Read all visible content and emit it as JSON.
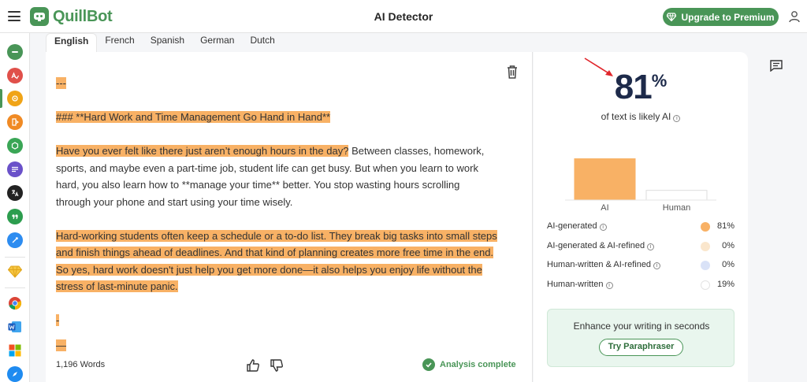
{
  "header": {
    "menu_icon": "hamburger-icon",
    "brand": "QuillBot",
    "title": "AI Detector",
    "premium_label": "Upgrade to Premium",
    "premium_icon": "diamond-icon",
    "account_icon": "user-icon"
  },
  "sidebar": {
    "items": [
      {
        "icon": "paraphraser-icon",
        "color": "#499557"
      },
      {
        "icon": "grammar-checker-icon",
        "color": "#e0504a"
      },
      {
        "icon": "ai-detector-icon",
        "color": "#f0a417",
        "active": true
      },
      {
        "icon": "plagiarism-checker-icon",
        "color": "#f08a24"
      },
      {
        "icon": "ai-humanizer-icon",
        "color": "#3aa656"
      },
      {
        "icon": "summarizer-icon",
        "color": "#6a51c9"
      },
      {
        "icon": "translator-icon",
        "color": "#222222"
      },
      {
        "icon": "citation-generator-icon",
        "color": "#2c9d4e"
      },
      {
        "icon": "quillbot-flow-icon",
        "color": "#2d8cf0"
      },
      {
        "icon": "premium-diamond-icon",
        "color": "#f0b323"
      },
      {
        "icon": "chrome-extension-icon",
        "color": "#4285f4"
      },
      {
        "icon": "word-addin-icon",
        "color": "#2b579a"
      },
      {
        "icon": "windows-app-icon",
        "color": "#f25022"
      },
      {
        "icon": "mac-app-icon",
        "color": "#1f8bf0"
      }
    ]
  },
  "tabs": [
    {
      "label": "English",
      "active": true
    },
    {
      "label": "French"
    },
    {
      "label": "Spanish"
    },
    {
      "label": "German"
    },
    {
      "label": "Dutch"
    }
  ],
  "editor": {
    "line1": "---",
    "heading": "### **Hard Work and Time Management Go Hand in Hand**",
    "p1_highlighted": "Have you ever felt like there just aren’t enough hours in the day?",
    "p1_rest": " Between classes, homework, sports, and maybe even a part-time job, student life can get busy. But when you learn to work hard, you also learn how to **manage your time** better. You stop wasting hours scrolling through your phone and start using your time wisely.",
    "p2_highlighted": "Hard-working students often keep a schedule or a to-do list. They break big tasks into small steps and finish things ahead of deadlines. And that kind of planning creates more free time in the end. So yes, hard work doesn't just help you get more done—it also helps you enjoy life without the stress of last-minute panic.",
    "trailing1": "-",
    "trailing2": "—",
    "word_count": "1,196 Words",
    "status": "Analysis complete",
    "trash_icon": "trash-icon",
    "like_icon": "thumbs-up-icon",
    "dislike_icon": "thumbs-down-icon"
  },
  "result": {
    "score": "81",
    "score_unit": "%",
    "likely_text": "of text is likely AI",
    "legend": [
      {
        "label": "AI-generated",
        "value": "81%",
        "color": "#f8b165"
      },
      {
        "label": "AI-generated & AI-refined",
        "value": "0%",
        "color": "#fae6cc"
      },
      {
        "label": "Human-written & AI-refined",
        "value": "0%",
        "color": "#d9e2f7"
      },
      {
        "label": "Human-written",
        "value": "19%",
        "color": "#ffffff"
      }
    ],
    "promo_text": "Enhance your writing in seconds",
    "promo_button": "Try Paraphraser"
  },
  "chart_data": {
    "type": "bar",
    "categories": [
      "AI",
      "Human"
    ],
    "values": [
      81,
      19
    ],
    "colors": [
      "#f8b165",
      "#ffffff"
    ],
    "ylim": [
      0,
      100
    ],
    "grid": false
  },
  "side_icon": "comment-icon",
  "annotation_color": "#e0262c"
}
